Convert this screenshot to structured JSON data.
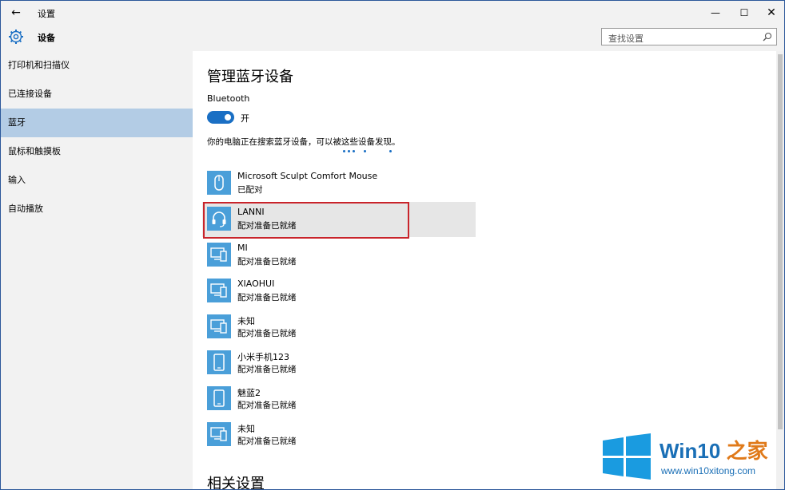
{
  "titlebar": {
    "back_label": "←",
    "app_title": "设置",
    "minimize_label": "—",
    "maximize_label": "☐",
    "close_label": "✕"
  },
  "header": {
    "section_title": "设备",
    "search_placeholder": "查找设置"
  },
  "sidebar": {
    "items": [
      {
        "label": "打印机和扫描仪"
      },
      {
        "label": "已连接设备"
      },
      {
        "label": "蓝牙",
        "selected": true
      },
      {
        "label": "鼠标和触摸板"
      },
      {
        "label": "输入"
      },
      {
        "label": "自动播放"
      }
    ]
  },
  "main": {
    "page_title": "管理蓝牙设备",
    "bluetooth_label": "Bluetooth",
    "toggle_state": "开",
    "toggle_on": true,
    "search_message": "你的电脑正在搜索蓝牙设备，可以被这些设备发现。",
    "devices": [
      {
        "name": "Microsoft Sculpt Comfort Mouse",
        "status": "已配对",
        "icon": "mouse-icon"
      },
      {
        "name": "LANNI",
        "status": "配对准备已就绪",
        "icon": "headset-icon",
        "highlighted": true
      },
      {
        "name": "MI",
        "status": "配对准备已就绪",
        "icon": "computer-phone-icon"
      },
      {
        "name": "XIAOHUI",
        "status": "配对准备已就绪",
        "icon": "computer-phone-icon"
      },
      {
        "name": "未知",
        "status": "配对准备已就绪",
        "icon": "computer-phone-icon"
      },
      {
        "name": "小米手机123",
        "status": "配对准备已就绪",
        "icon": "phone-icon"
      },
      {
        "name": "魅蓝2",
        "status": "配对准备已就绪",
        "icon": "phone-icon"
      },
      {
        "name": "未知",
        "status": "配对准备已就绪",
        "icon": "computer-phone-icon"
      }
    ],
    "related_settings_title": "相关设置"
  },
  "watermark": {
    "brand_prefix": "Win10 ",
    "brand_suffix": "之家",
    "url": "www.win10xitong.com"
  },
  "colors": {
    "accent": "#1a6fc4",
    "device_icon_bg": "#4a9fd9",
    "selected_nav": "#b3cce5",
    "highlight_border": "#c9242b"
  }
}
